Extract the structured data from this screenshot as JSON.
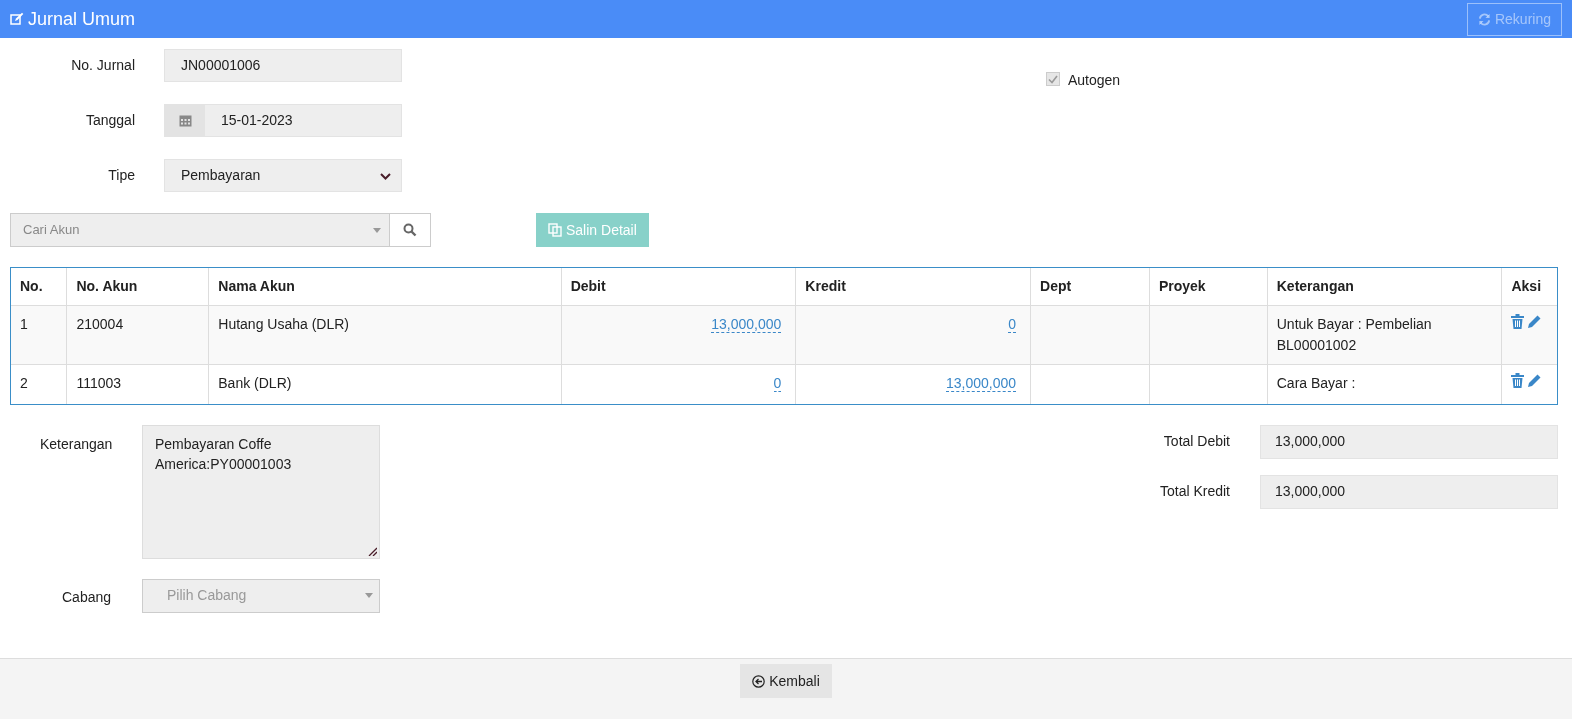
{
  "header": {
    "title": "Jurnal Umum",
    "rekuring_button": {
      "label": "Rekuring",
      "disabled": true
    }
  },
  "form": {
    "fields": [
      {
        "kind": "text",
        "label": "No. Jurnal",
        "value": "JN00001006"
      },
      {
        "kind": "date",
        "label": "Tanggal",
        "value": "15-01-2023"
      },
      {
        "kind": "select",
        "label": "Tipe",
        "value": "Pembayaran"
      }
    ],
    "autogen": {
      "label": "Autogen",
      "checked": true,
      "disabled": true
    }
  },
  "account_search": {
    "placeholder": "Cari Akun",
    "disabled": true
  },
  "copy_detail_button": {
    "label": "Salin Detail",
    "disabled": true
  },
  "table": {
    "columns": [
      "No.",
      "No. Akun",
      "Nama Akun",
      "Debit",
      "Kredit",
      "Dept",
      "Proyek",
      "Keterangan",
      "Aksi"
    ],
    "rows": [
      {
        "no": "1",
        "account_no": "210004",
        "account_name": "Hutang Usaha (DLR)",
        "debit": "13,000,000",
        "kredit": "0",
        "keterangan": "Untuk Bayar : Pembelian BL00001002"
      },
      {
        "no": "2",
        "account_no": "111003",
        "account_name": "Bank (DLR)",
        "debit": "0",
        "kredit": "13,000,000",
        "keterangan": "Cara Bayar :"
      }
    ]
  },
  "notes": {
    "label": "Keterangan",
    "value": "Pembayaran Coffe America:PY00001003"
  },
  "branch": {
    "label": "Cabang",
    "placeholder": "Pilih Cabang",
    "disabled": true
  },
  "totals": [
    {
      "label": "Total Debit",
      "value": "13,000,000"
    },
    {
      "label": "Total Kredit",
      "value": "13,000,000"
    }
  ],
  "footer": {
    "back_button": "Kembali"
  }
}
